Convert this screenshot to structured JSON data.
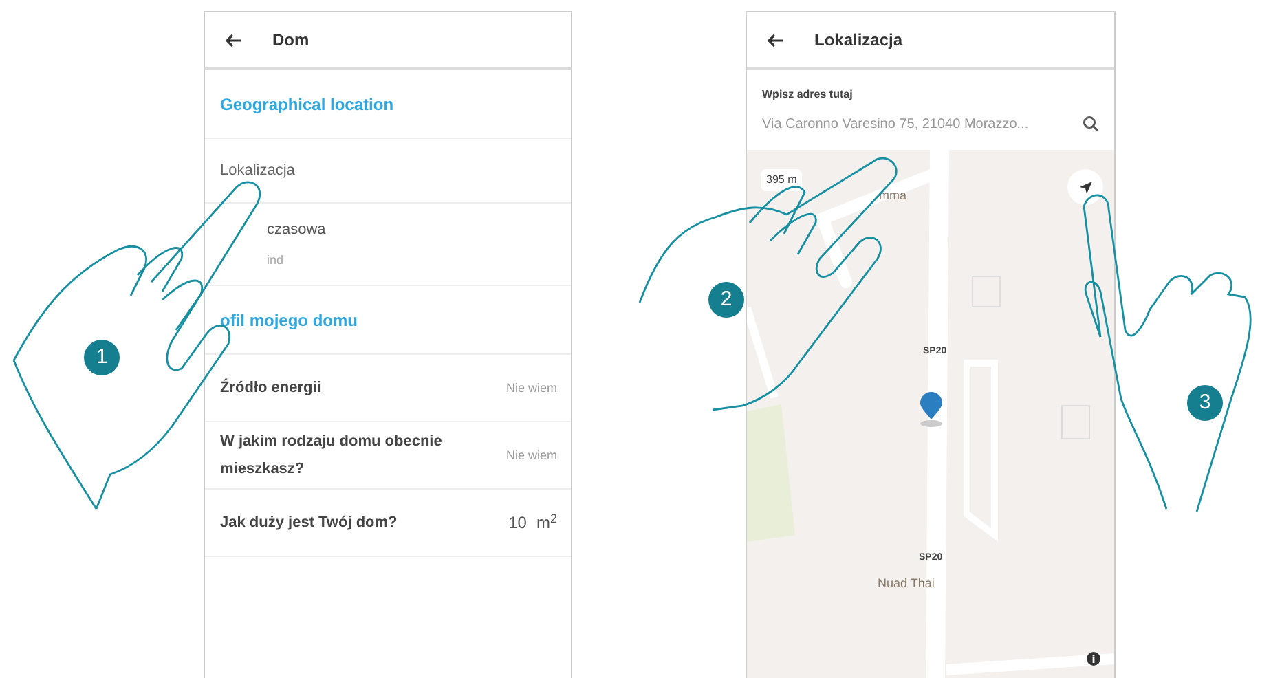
{
  "left_screen": {
    "title": "Dom",
    "rows": [
      {
        "kind": "section",
        "label": "Geographical location"
      },
      {
        "kind": "item",
        "label": "Lokalizacja"
      },
      {
        "kind": "item_sub",
        "label": "czasowa",
        "sublabel": "ind"
      },
      {
        "kind": "section",
        "label": "ofil mojego domu"
      },
      {
        "kind": "setting",
        "label": "Źródło energii",
        "value": "Nie wiem"
      },
      {
        "kind": "setting",
        "label": "W jakim rodzaju domu obecnie mieszkasz?",
        "value": "Nie wiem"
      },
      {
        "kind": "setting",
        "label": "Jak duży jest Twój dom?",
        "value": "10",
        "unit": "m$^{2}$"
      }
    ]
  },
  "right_screen": {
    "title": "Lokalizacja",
    "search": {
      "label": "Wpisz adres tutaj",
      "value": "Via Caronno Varesino 75, 21040 Morazzo..."
    },
    "map": {
      "scale": "395 m",
      "labels": [
        {
          "kind": "place",
          "text": "mma"
        },
        {
          "kind": "road",
          "text": "SP20"
        },
        {
          "kind": "road",
          "text": "SP20"
        },
        {
          "kind": "place",
          "text": "Nuad Thai"
        }
      ]
    }
  },
  "step_markers": [
    "1",
    "2",
    "3"
  ]
}
